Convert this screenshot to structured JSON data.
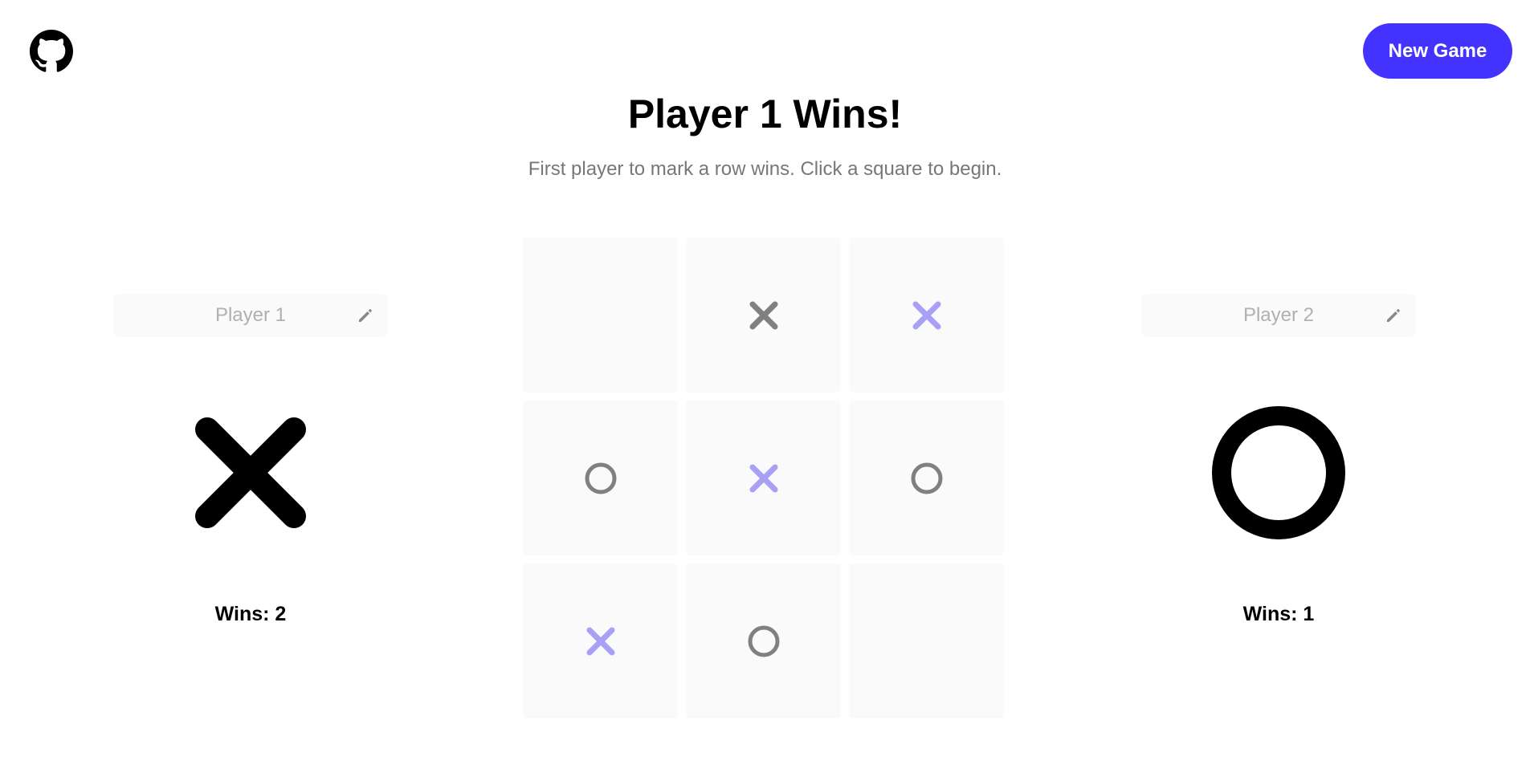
{
  "header": {
    "github_icon": "github-icon",
    "new_game_label": "New Game"
  },
  "status": {
    "title": "Player 1 Wins!",
    "subtitle": "First player to mark a row wins. Click a square to begin."
  },
  "players": [
    {
      "placeholder": "Player 1",
      "symbol": "X",
      "wins_label": "Wins: 2",
      "edit_icon": "pencil-icon"
    },
    {
      "placeholder": "Player 2",
      "symbol": "O",
      "wins_label": "Wins: 1",
      "edit_icon": "pencil-icon"
    }
  ],
  "board": {
    "cells": [
      "",
      "X",
      "X",
      "O",
      "X",
      "O",
      "X",
      "O",
      ""
    ],
    "highlighted": [
      2,
      4,
      6
    ]
  },
  "colors": {
    "accent": "#4433ff",
    "mark_default": "#808080",
    "mark_win": "#a89ff7",
    "cell_bg": "#fafafa"
  }
}
